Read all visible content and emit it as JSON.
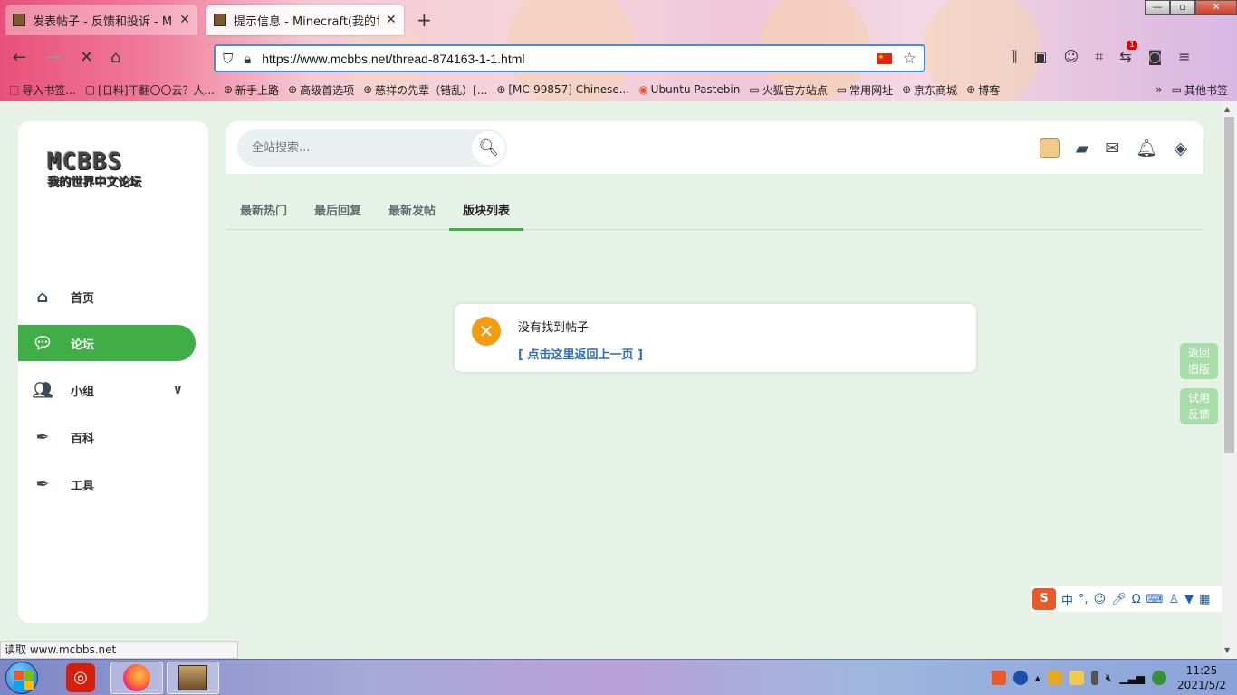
{
  "browser": {
    "tabs": [
      {
        "title": "发表帖子 - 反馈和投诉 - Minec",
        "active": false
      },
      {
        "title": "提示信息 - Minecraft(我的世界",
        "active": true
      }
    ],
    "url": "https://www.mcbbs.net/thread-874163-1-1.html",
    "bookmarks": [
      {
        "label": "导入书签...",
        "icon": "import-icon"
      },
      {
        "label": "[日料]干翻〇〇云？人...",
        "icon": "page-icon"
      },
      {
        "label": "新手上路",
        "icon": "globe-icon"
      },
      {
        "label": "高级首选项",
        "icon": "globe-icon"
      },
      {
        "label": "慈祥の先辈（错乱）[...",
        "icon": "globe-icon"
      },
      {
        "label": "[MC-99857] Chinese...",
        "icon": "globe-icon"
      },
      {
        "label": "Ubuntu Pastebin",
        "icon": "ubuntu-icon"
      },
      {
        "label": "火狐官方站点",
        "icon": "folder-icon"
      },
      {
        "label": "常用网址",
        "icon": "folder-icon"
      },
      {
        "label": "京东商城",
        "icon": "globe-icon"
      },
      {
        "label": "博客",
        "icon": "globe-icon"
      }
    ],
    "other_bookmarks": "其他书签",
    "notification_badge": "1",
    "status_text": "读取 www.mcbbs.net"
  },
  "site": {
    "logo_line1": "MCBBS",
    "logo_line2": "我的世界中文论坛",
    "menu": [
      {
        "label": "首页",
        "icon": "home-icon",
        "active": false
      },
      {
        "label": "论坛",
        "icon": "comments-icon",
        "active": true
      },
      {
        "label": "小组",
        "icon": "users-icon",
        "active": false
      },
      {
        "label": "百科",
        "icon": "feather-icon",
        "active": false
      },
      {
        "label": "工具",
        "icon": "feather-icon",
        "active": false
      }
    ],
    "search_placeholder": "全站搜索...",
    "tabs": [
      {
        "label": "最新热门",
        "active": false
      },
      {
        "label": "最后回复",
        "active": false
      },
      {
        "label": "最新发帖",
        "active": false
      },
      {
        "label": "版块列表",
        "active": true
      }
    ],
    "alert": {
      "message": "没有找到帖子",
      "link": "[ 点击这里返回上一页 ]"
    },
    "side_buttons": [
      "返回旧版",
      "试用反馈"
    ],
    "accent_color": "#3fae46"
  },
  "ime": {
    "mode": "中"
  },
  "taskbar": {
    "time": "11:25",
    "date": "2021/5/2"
  }
}
